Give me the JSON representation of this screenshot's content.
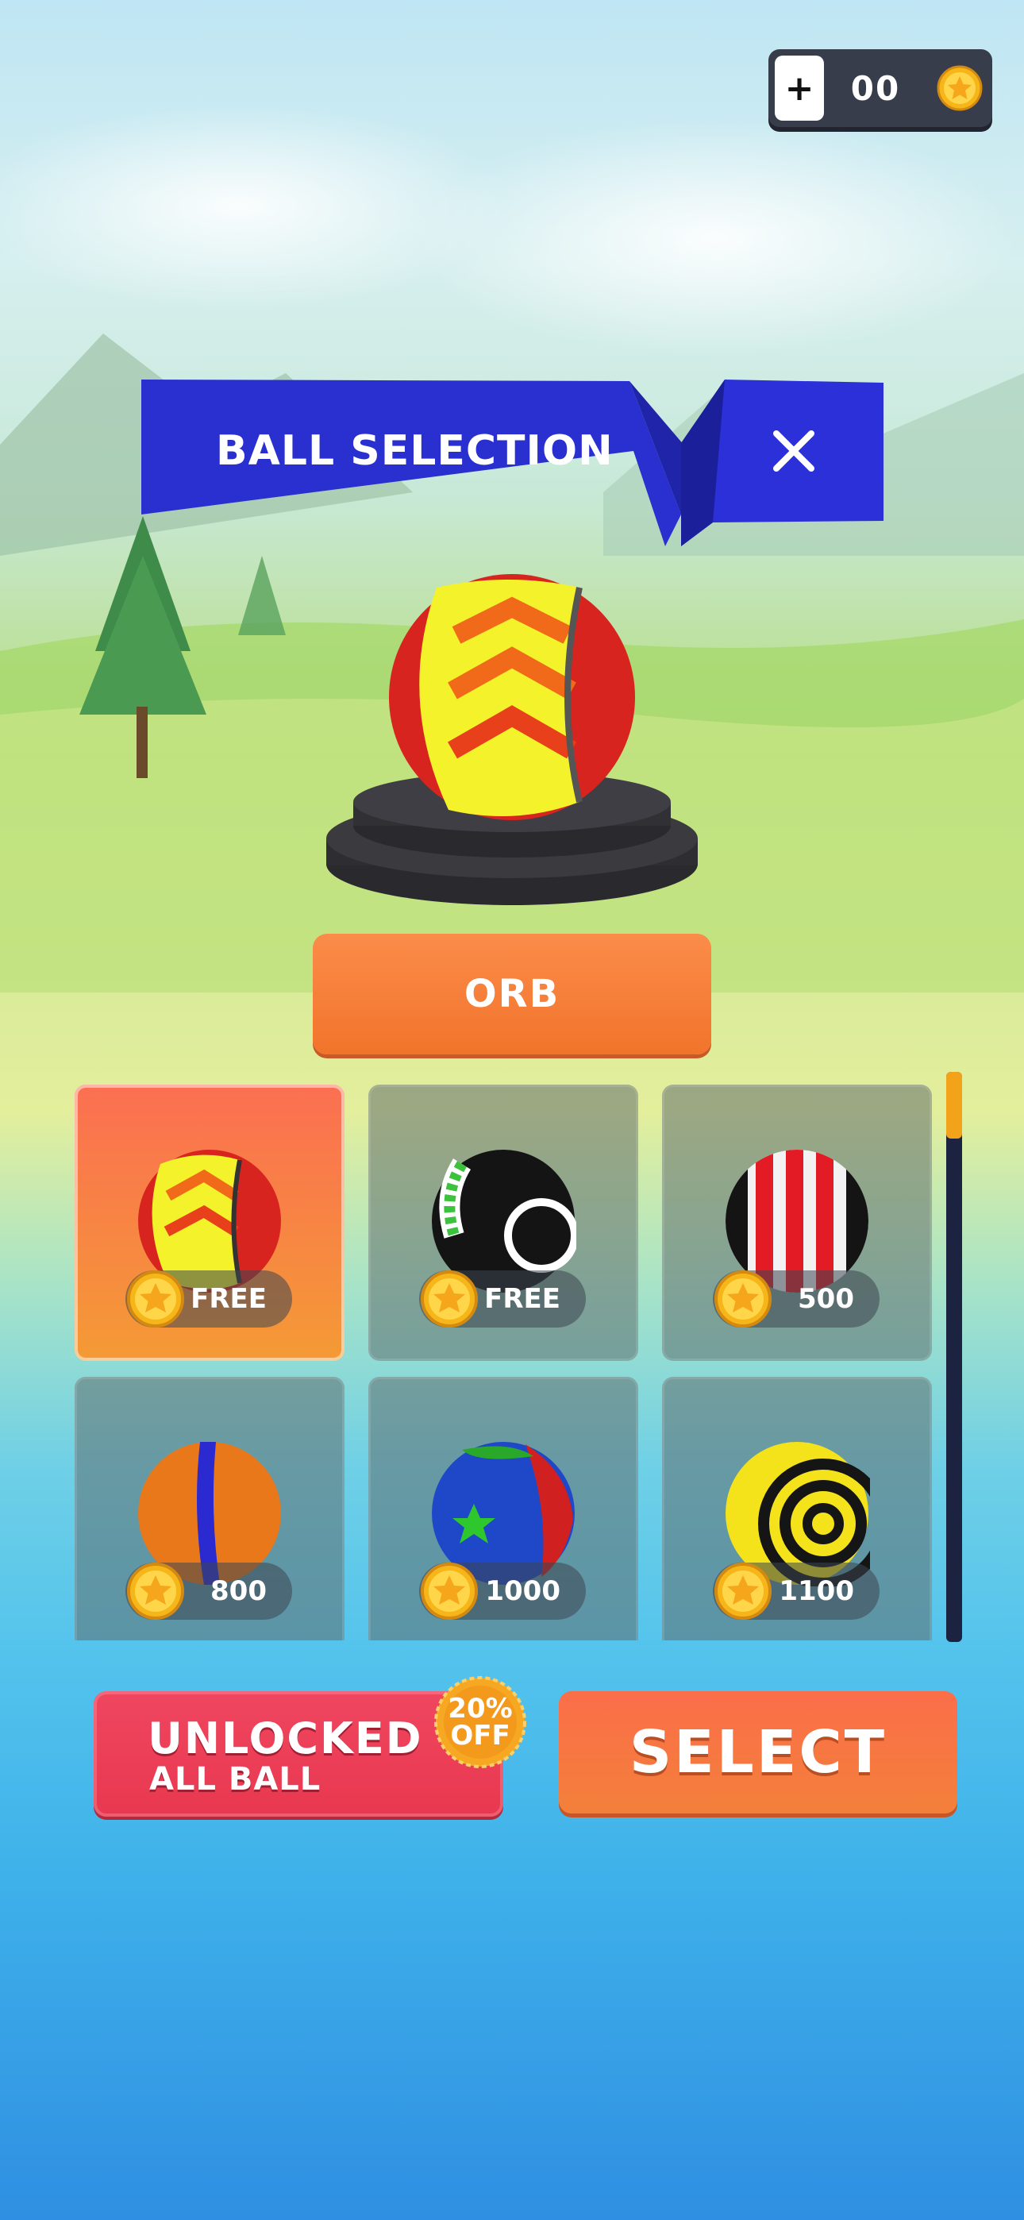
{
  "currency": {
    "plus_label": "+",
    "amount": "00",
    "icon": "coin-star-icon"
  },
  "header": {
    "title": "BALL SELECTION",
    "close_icon": "close-icon"
  },
  "preview": {
    "ball_name": "ORB"
  },
  "balls": [
    {
      "price": "FREE",
      "selected": true,
      "style": "orb"
    },
    {
      "price": "FREE",
      "selected": false,
      "style": "black-green"
    },
    {
      "price": "500",
      "selected": false,
      "style": "red-white-stripe"
    },
    {
      "price": "800",
      "selected": false,
      "style": "orange-blue"
    },
    {
      "price": "1000",
      "selected": false,
      "style": "blue-green-star"
    },
    {
      "price": "1100",
      "selected": false,
      "style": "yellow-black-rings"
    }
  ],
  "unlock": {
    "line1": "UNLOCKED",
    "line2": "ALL BALL",
    "discount_line1": "20%",
    "discount_line2": "OFF"
  },
  "select_label": "SELECT",
  "colors": {
    "accent_orange": "#f2742b",
    "banner_blue": "#2b2fd6",
    "unlock_red": "#e8384f",
    "coin_gold": "#f6c21a"
  }
}
